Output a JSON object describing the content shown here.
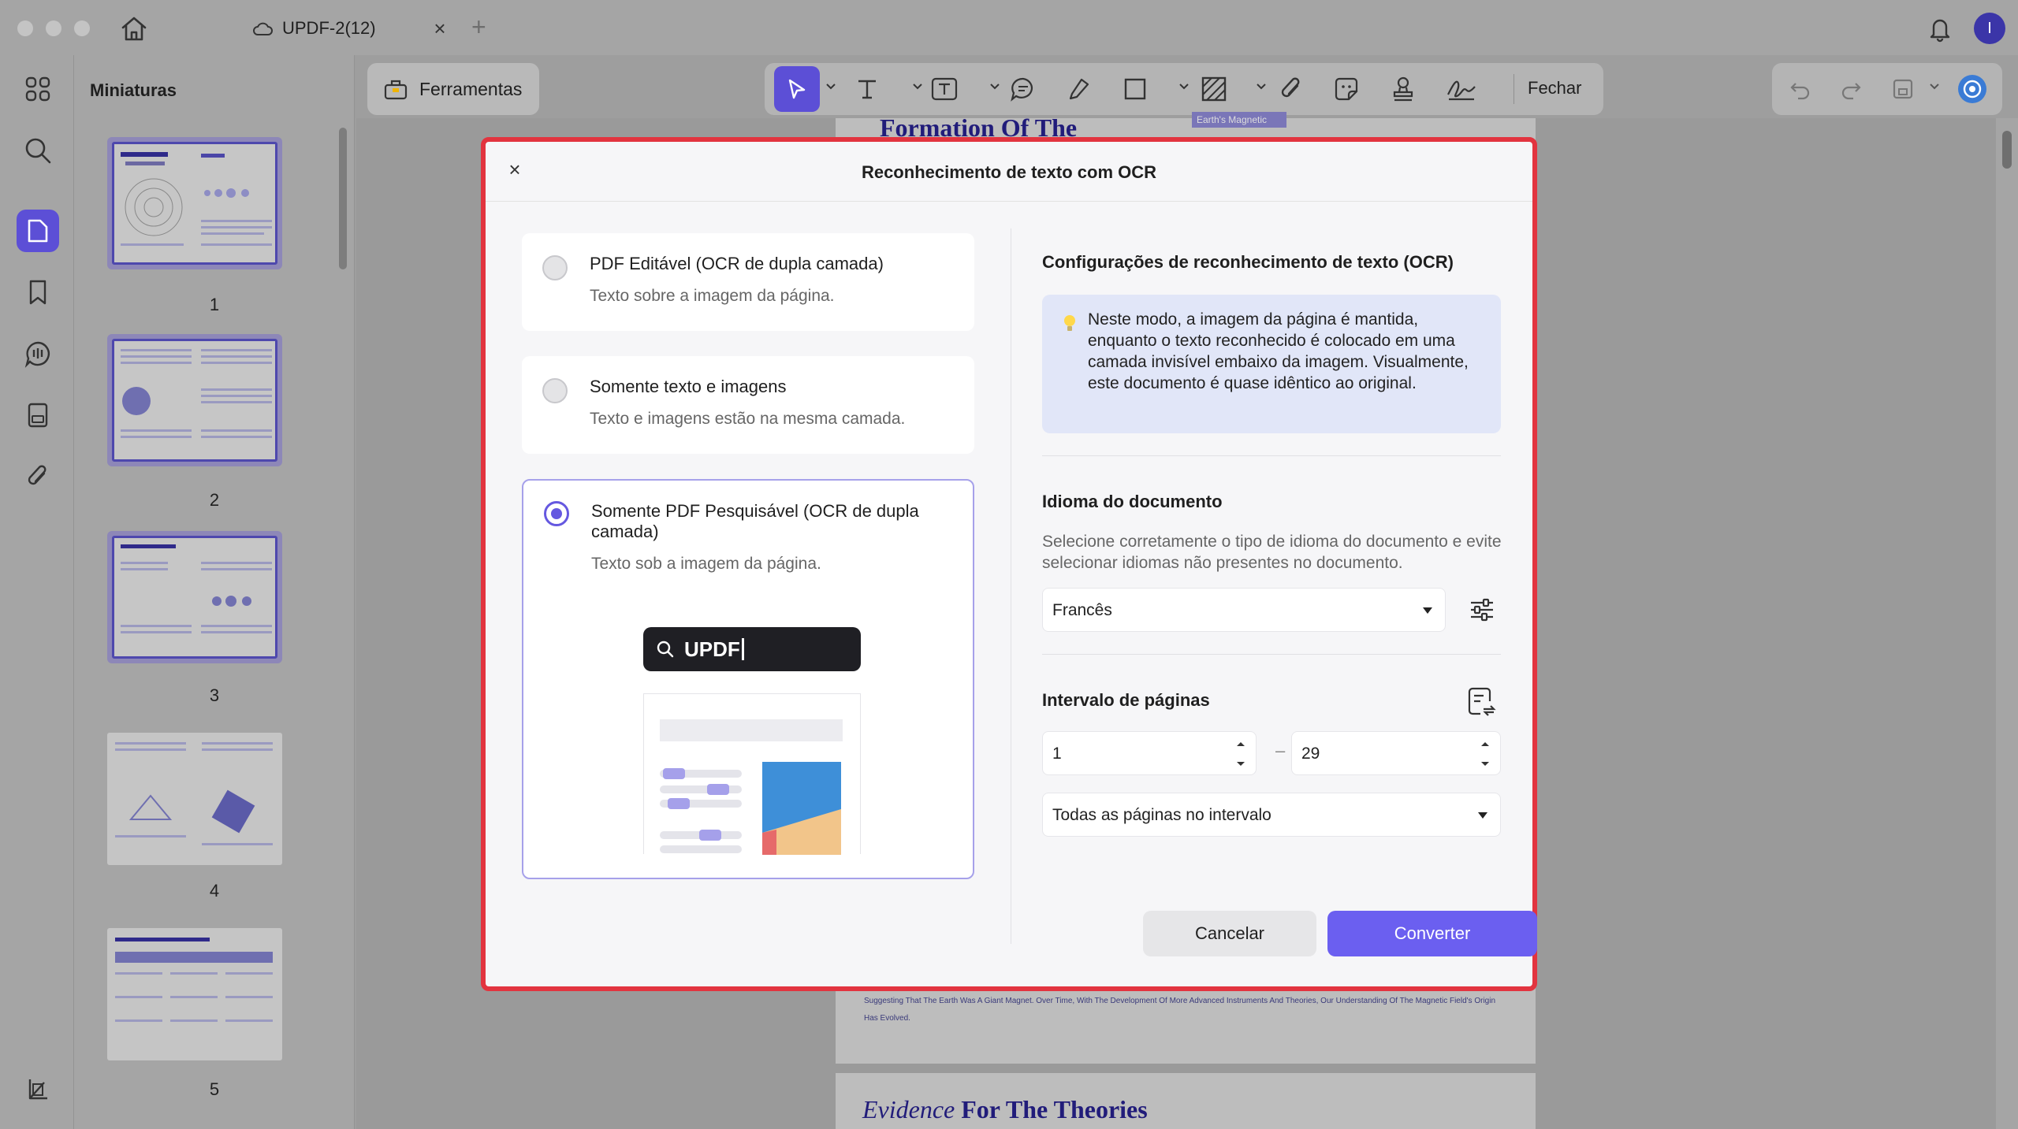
{
  "window": {
    "tab_title": "UPDF-2(12)",
    "tab_close": "×",
    "tab_add": "+",
    "profile_initial": "I"
  },
  "sidebar": {
    "panel_title": "Miniaturas",
    "thumbnails": [
      {
        "label": "1",
        "selected": true
      },
      {
        "label": "2",
        "selected": true
      },
      {
        "label": "3",
        "selected": true
      },
      {
        "label": "4",
        "selected": false
      },
      {
        "label": "5",
        "selected": false
      }
    ],
    "icons": [
      "grid-icon",
      "search-icon",
      "thumbnails-icon",
      "bookmark-icon",
      "comment-icon",
      "document-icon",
      "attachment-icon",
      "layers-icon"
    ]
  },
  "toolbar": {
    "tools_label": "Ferramentas",
    "close_label": "Fechar",
    "icons": [
      "select-icon",
      "text-icon",
      "textbox-icon",
      "comment-icon",
      "highlight-icon",
      "rectangle-icon",
      "pattern-icon",
      "attachment-icon",
      "sticker-icon",
      "stamp-icon",
      "signature-icon"
    ]
  },
  "document": {
    "heading_1": "Formation Of The",
    "tag_1": "Earth's Magnetic",
    "body_text": "Suggesting That The Earth Was A Giant Magnet. Over Time, With The Development Of More Advanced Instruments And Theories, Our Understanding Of The Magnetic Field's Origin Has Evolved.",
    "heading_2_italic": "Evidence",
    "heading_2_rest": "For The Theories"
  },
  "dialog": {
    "title": "Reconhecimento de texto com OCR",
    "close": "×",
    "options": [
      {
        "title": "PDF Editável (OCR de dupla camada)",
        "desc": "Texto sobre a imagem da página.",
        "selected": false
      },
      {
        "title": "Somente texto e imagens",
        "desc": "Texto e imagens estão na mesma camada.",
        "selected": false
      },
      {
        "title": "Somente PDF Pesquisável (OCR de dupla camada)",
        "desc": "Texto sob a imagem da página.",
        "selected": true
      }
    ],
    "preview_search_text": "UPDF",
    "settings_title": "Configurações de reconhecimento de texto (OCR)",
    "info_text": "Neste modo, a imagem da página é mantida, enquanto o texto reconhecido é colocado em uma camada invisível embaixo da imagem. Visualmente, este documento é quase idêntico ao original.",
    "language_title": "Idioma do documento",
    "language_help": "Selecione corretamente o tipo de idioma do documento e evite selecionar idiomas não presentes no documento.",
    "language_value": "Francês",
    "range_title": "Intervalo de páginas",
    "range_from": "1",
    "range_to": "29",
    "range_dash": "–",
    "range_mode": "Todas as páginas no intervalo",
    "cancel_label": "Cancelar",
    "convert_label": "Converter"
  },
  "colors": {
    "accent": "#6b5ff0",
    "highlight_border": "#e2343f",
    "info_bg": "#e1e6f8"
  }
}
